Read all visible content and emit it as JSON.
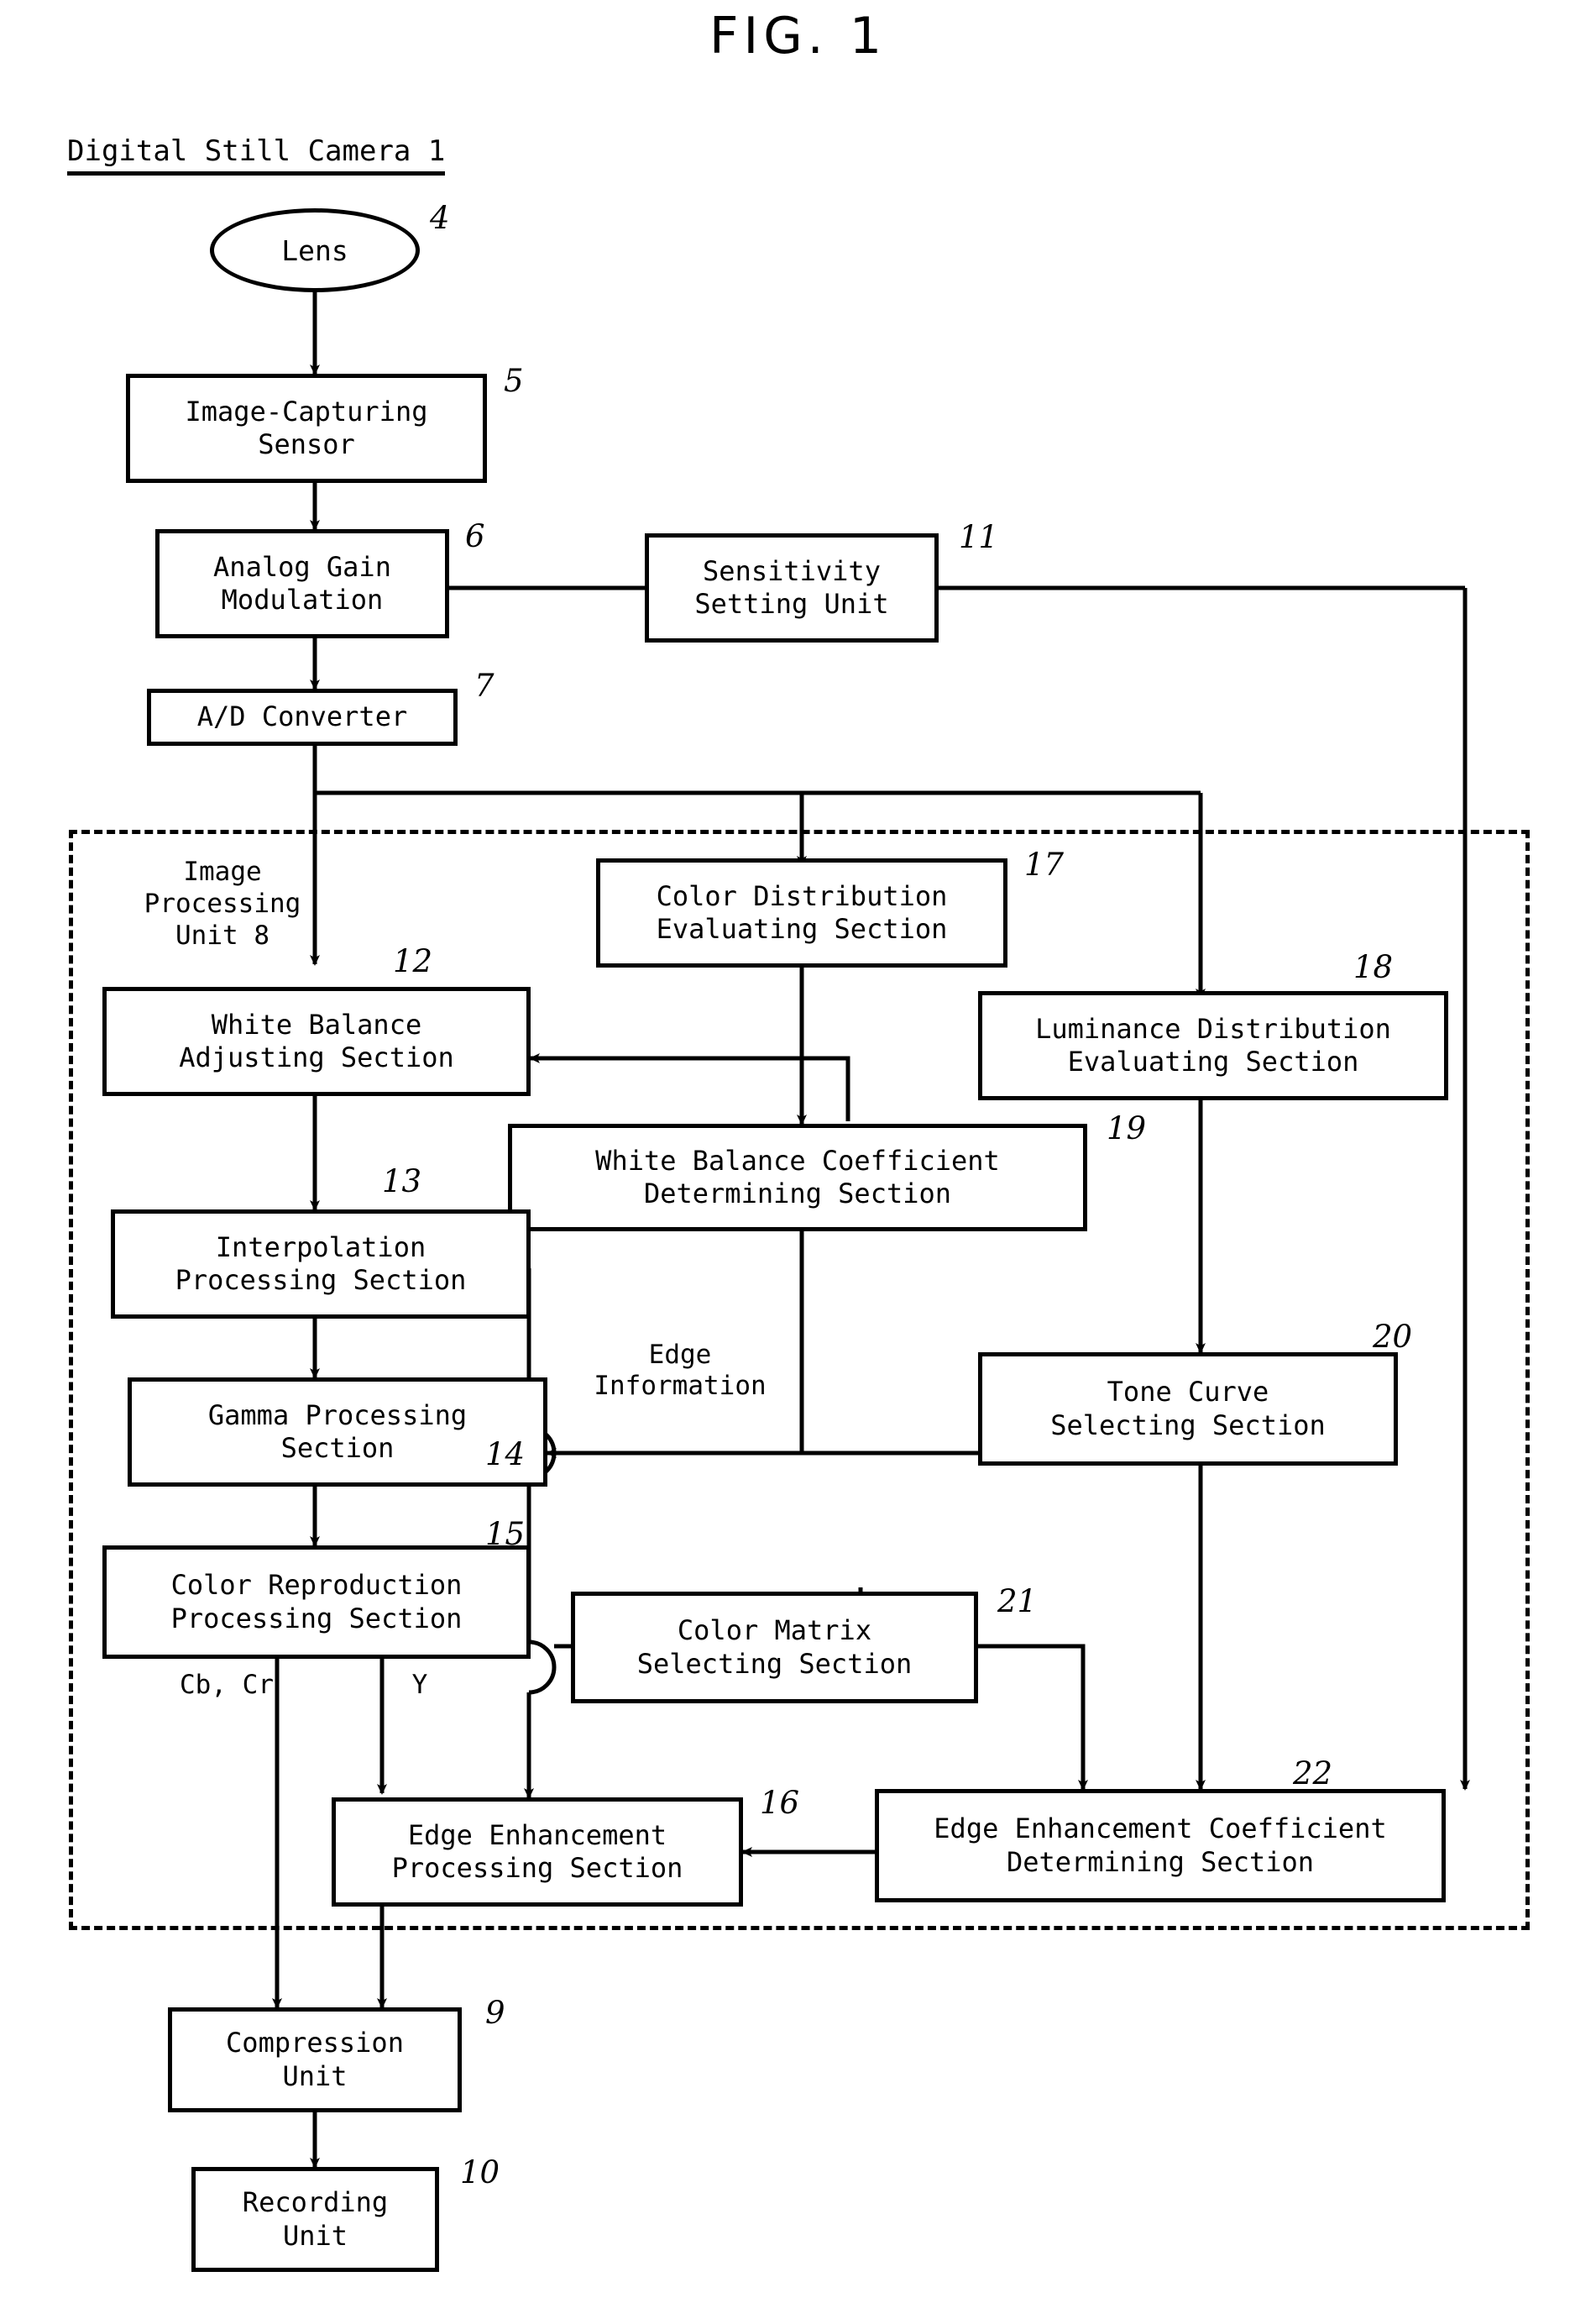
{
  "figure": {
    "title": "FIG. 1",
    "system_label": "Digital Still Camera 1",
    "group_label": "Image\nProcessing\nUnit 8"
  },
  "blocks": [
    {
      "id": "lens",
      "label": "Lens",
      "ref": "4"
    },
    {
      "id": "sensor",
      "label": "Image-Capturing\nSensor",
      "ref": "5"
    },
    {
      "id": "again",
      "label": "Analog Gain\nModulation",
      "ref": "6"
    },
    {
      "id": "adc",
      "label": "A/D Converter",
      "ref": "7"
    },
    {
      "id": "sens",
      "label": "Sensitivity\nSetting Unit",
      "ref": "11"
    },
    {
      "id": "wb",
      "label": "White Balance\nAdjusting Section",
      "ref": "12"
    },
    {
      "id": "interp",
      "label": "Interpolation\nProcessing Section",
      "ref": "13"
    },
    {
      "id": "gamma",
      "label": "Gamma Processing\nSection",
      "ref": "14"
    },
    {
      "id": "colrep",
      "label": "Color Reproduction\nProcessing Section",
      "ref": "15"
    },
    {
      "id": "edgep",
      "label": "Edge Enhancement\nProcessing Section",
      "ref": "16"
    },
    {
      "id": "cdist",
      "label": "Color Distribution\nEvaluating Section",
      "ref": "17"
    },
    {
      "id": "ldist",
      "label": "Luminance Distribution\nEvaluating Section",
      "ref": "18"
    },
    {
      "id": "wbcoef",
      "label": "White Balance Coefficient\nDetermining Section",
      "ref": "19"
    },
    {
      "id": "tone",
      "label": "Tone Curve\nSelecting Section",
      "ref": "20"
    },
    {
      "id": "cmat",
      "label": "Color Matrix\nSelecting Section",
      "ref": "21"
    },
    {
      "id": "edgec",
      "label": "Edge Enhancement Coefficient\nDetermining Section",
      "ref": "22"
    }
  ],
  "signals": {
    "edge_information": "Edge\nInformation",
    "cbcr": "Cb, Cr",
    "y": "Y"
  },
  "tail_blocks": [
    {
      "id": "comp",
      "label": "Compression\nUnit",
      "ref": "9"
    },
    {
      "id": "rec",
      "label": "Recording\nUnit",
      "ref": "10"
    }
  ],
  "colors": {
    "ink": "#000000",
    "paper": "#ffffff"
  }
}
